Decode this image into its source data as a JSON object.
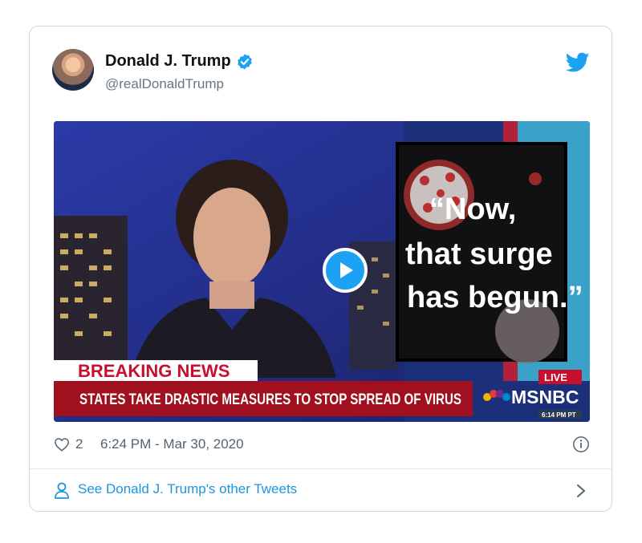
{
  "tweet": {
    "author_name": "Donald J. Trump",
    "author_handle": "@realDonaldTrump",
    "likes": "2",
    "timestamp": "6:24 PM - Mar 30, 2020",
    "footer_link": "See Donald J. Trump's other Tweets"
  },
  "media": {
    "chyron_label": "BREAKING NEWS",
    "chyron_text": "STATES TAKE DRASTIC MEASURES TO STOP SPREAD OF VIRUS",
    "quote_line1": "“Now,",
    "quote_line2": "that surge",
    "quote_line3": "has begun.”",
    "live_badge": "LIVE",
    "network": "MSNBC",
    "network_time": "6:14 PM PT"
  },
  "colors": {
    "accent": "#1da1f2",
    "text_secondary": "#657786",
    "link": "#1b95e0",
    "breaking_red": "#c8102e"
  },
  "icons": [
    "verified-icon",
    "twitter-bird-icon",
    "play-icon",
    "heart-icon",
    "info-icon",
    "person-icon",
    "chevron-right-icon"
  ]
}
